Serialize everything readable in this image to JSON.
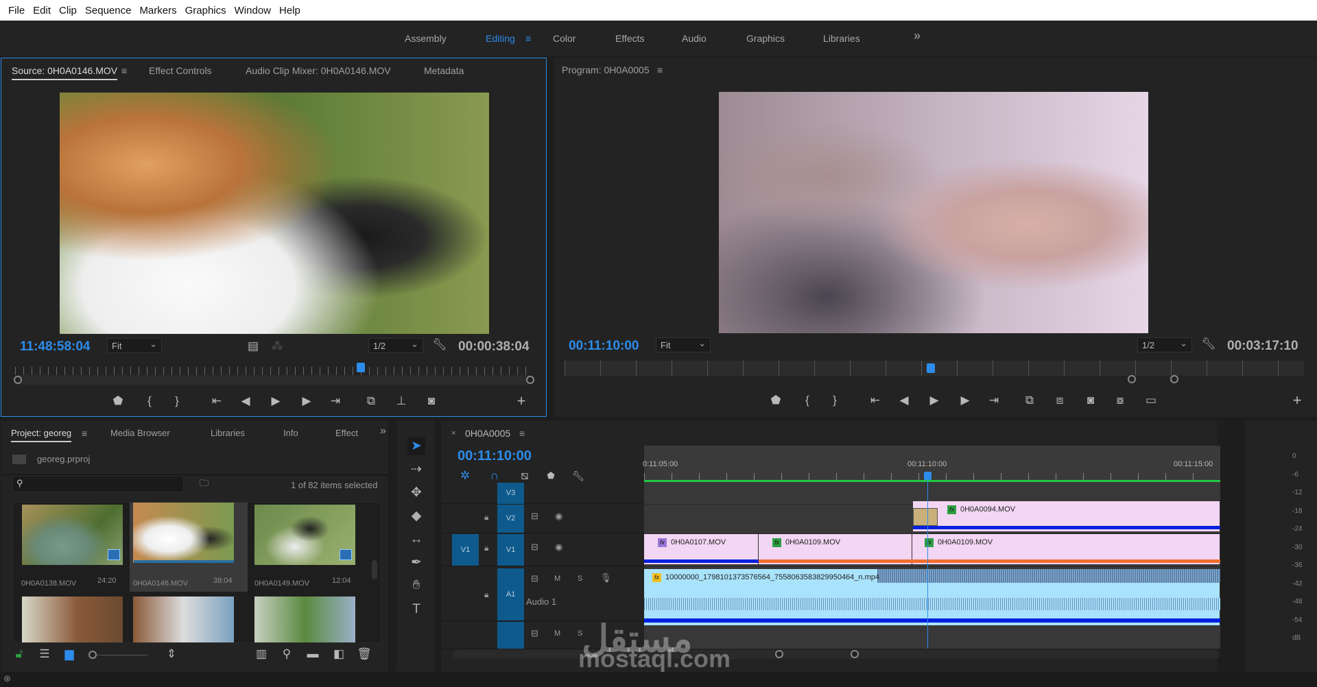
{
  "menu": [
    "File",
    "Edit",
    "Clip",
    "Sequence",
    "Markers",
    "Graphics",
    "Window",
    "Help"
  ],
  "workspaces": [
    {
      "label": "Assembly"
    },
    {
      "label": "Editing",
      "active": true
    },
    {
      "label": "Color"
    },
    {
      "label": "Effects"
    },
    {
      "label": "Audio"
    },
    {
      "label": "Graphics"
    },
    {
      "label": "Libraries"
    }
  ],
  "workspace_overflow": "»",
  "source": {
    "tabs": [
      "Source: 0H0A0146.MOV",
      "Effect Controls",
      "Audio Clip Mixer: 0H0A0146.MOV",
      "Metadata"
    ],
    "timecode": "11:48:58:04",
    "zoom": "Fit",
    "resolution": "1/2",
    "duration": "00:00:38:04",
    "playhead_fraction": 0.66
  },
  "program": {
    "title": "Program: 0H0A0005",
    "timecode": "00:11:10:00",
    "zoom": "Fit",
    "resolution": "1/2",
    "duration": "00:03:17:10",
    "playhead_fraction": 0.49
  },
  "project": {
    "tabs": [
      "Project: georeg",
      "Media Browser",
      "Libraries",
      "Info",
      "Effect"
    ],
    "file": "georeg.prproj",
    "search_placeholder": "",
    "selection_status": "1 of 82 items selected",
    "items": [
      {
        "name": "0H0A0138.MOV",
        "duration": "24:20"
      },
      {
        "name": "0H0A0146.MOV",
        "duration": "38:04",
        "selected": true
      },
      {
        "name": "0H0A0149.MOV",
        "duration": "12:04"
      },
      {
        "name": "",
        "duration": ""
      },
      {
        "name": "",
        "duration": ""
      },
      {
        "name": "",
        "duration": ""
      }
    ]
  },
  "timeline": {
    "sequence": "0H0A0005",
    "timecode": "00:11:10:00",
    "ruler": [
      "0:11:05:00",
      "00:11:10:00",
      "00:11:15:00"
    ],
    "tracks": {
      "v3": "V3",
      "v2": "V2",
      "v1": "V1",
      "src_v1": "V1",
      "a1": "A1",
      "a1_name": "Audio 1",
      "m": "M",
      "s": "S"
    },
    "clips": {
      "v2": "0H0A0094.MOV",
      "v1a": "0H0A0107.MOV",
      "v1b": "0H0A0109.MOV",
      "v1c": "0H0A0109.MOV",
      "a1": "10000000_1798101373576564_7558063583829950464_n.mp4",
      "fx": "fx"
    }
  },
  "meter": [
    "0",
    "-6",
    "-12",
    "-18",
    "-24",
    "-30",
    "-36",
    "-42",
    "-48",
    "-54",
    "dB"
  ],
  "watermark": {
    "arabic": "مستقل",
    "latin": "mostaql.com"
  },
  "colors": {
    "accent": "#2d8ceb",
    "clip_pink": "#f3d6f3",
    "audio_clip": "#a9e3fb",
    "track_blue": "#0f5a8c"
  }
}
